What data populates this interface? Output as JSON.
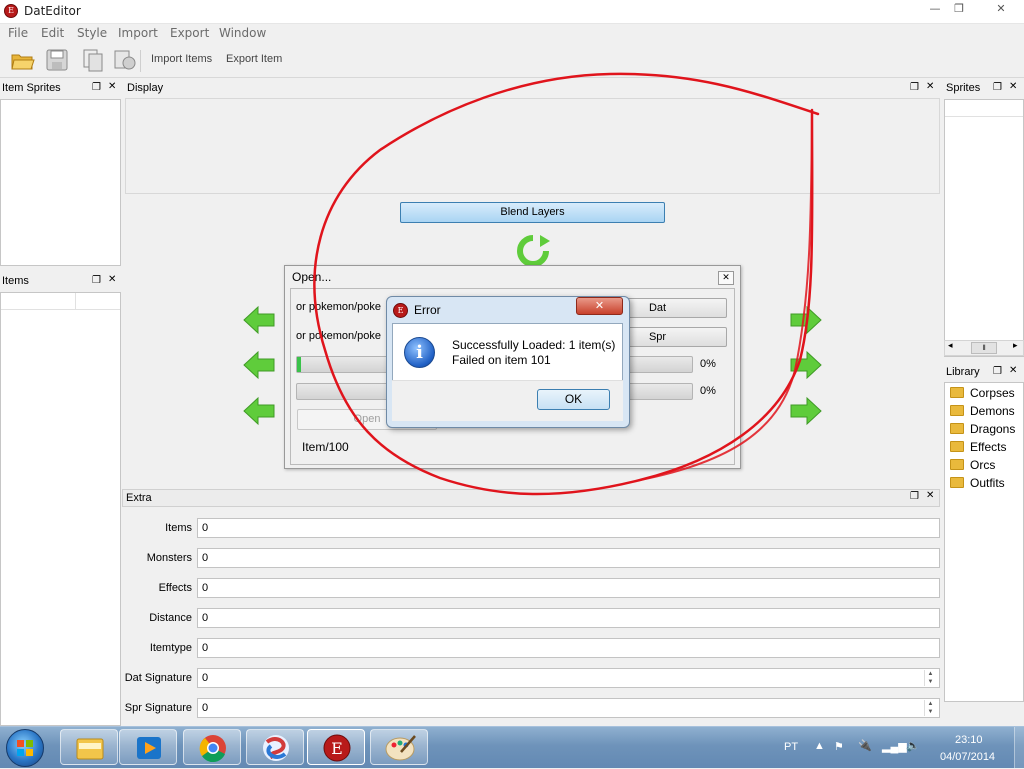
{
  "window": {
    "title": "DatEditor",
    "controls": {
      "minimize": "—",
      "maximize": "❐",
      "close": "✕"
    }
  },
  "menu": [
    "File",
    "Edit",
    "Style",
    "Import",
    "Export",
    "Window"
  ],
  "toolbar": {
    "icons": [
      "open-folder-icon",
      "save-icon",
      "copy-icon",
      "compile-icon"
    ],
    "import_items": "Import Items",
    "export_item": "Export Item"
  },
  "docks": {
    "item_sprites": {
      "title": "Item Sprites"
    },
    "items": {
      "title": "Items"
    },
    "display": {
      "title": "Display"
    },
    "sprites": {
      "title": "Sprites"
    },
    "library": {
      "title": "Library",
      "items": [
        "Corpses",
        "Demons",
        "Dragons",
        "Effects",
        "Orcs",
        "Outfits"
      ]
    },
    "extra": {
      "title": "Extra"
    }
  },
  "display": {
    "blend_label": "Blend Layers"
  },
  "extra_fields": [
    {
      "label": "Items",
      "value": "0"
    },
    {
      "label": "Monsters",
      "value": "0"
    },
    {
      "label": "Effects",
      "value": "0"
    },
    {
      "label": "Distance",
      "value": "0"
    },
    {
      "label": "Itemtype",
      "value": "0"
    },
    {
      "label": "Dat Signature",
      "value": "0"
    },
    {
      "label": "Spr Signature",
      "value": "0"
    }
  ],
  "open_dialog": {
    "title": "Open...",
    "dat_path": "or pokemon/poke",
    "spr_path": "or pokemon/poke",
    "dat_button": "Dat",
    "spr_button": "Spr",
    "progress1_pct": "0%",
    "progress1_value": 0.01,
    "progress2_pct": "0%",
    "progress2_value": 0,
    "open_label": "Open",
    "status": "Item/100"
  },
  "error_dialog": {
    "title": "Error",
    "line1": "Successfully Loaded: 1 item(s)",
    "line2": "Failed on item 101",
    "ok_label": "OK"
  },
  "taskbar": {
    "apps": [
      "explorer",
      "media-player",
      "chrome",
      "app",
      "dateditor",
      "paint"
    ],
    "language": "PT",
    "time": "23:10",
    "date": "04/07/2014"
  },
  "colors": {
    "annotation": "#e0141c",
    "arrow": "#5fcc3b",
    "accent": "#3c7fb1"
  }
}
